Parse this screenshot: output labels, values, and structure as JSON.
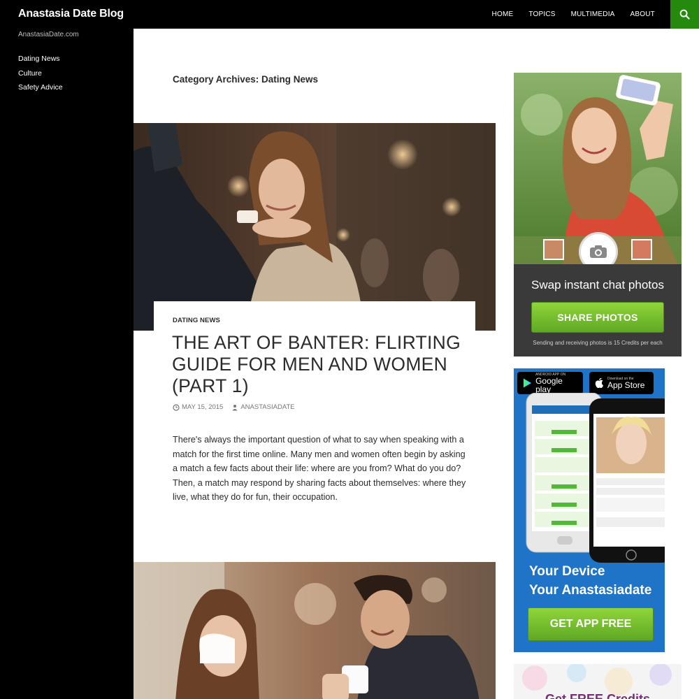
{
  "header": {
    "site_title": "Anastasia Date Blog",
    "nav": [
      "HOME",
      "TOPICS",
      "MULTIMEDIA",
      "ABOUT"
    ],
    "search_icon": "search-icon",
    "accent_color": "#24890d"
  },
  "sidebar": {
    "tagline": "AnastasiaDate.com",
    "categories": [
      "Dating News",
      "Culture",
      "Safety Advice"
    ]
  },
  "main": {
    "archive_title": "Category Archives: Dating News",
    "post": {
      "category": "DATING NEWS",
      "title": "THE ART OF BANTER: FLIRTING GUIDE FOR MEN AND WOMEN (PART 1)",
      "date": "MAY 15, 2015",
      "author": "ANASTASIADATE",
      "excerpt": "There's always the important question of what to say when speaking with a match for the first time online. Many men and women often begin by asking a match a few facts about their life: where are you from? What do you do? Then, a match may respond by sharing facts about themselves: where they live, what they do for fun, their occupation."
    }
  },
  "ads": {
    "photo_ad": {
      "headline": "Swap instant chat photos",
      "button": "SHARE PHOTOS",
      "note": "Sending and receiving photos is 15 Credits per each"
    },
    "app_ad": {
      "google_small": "ANDROID APP ON",
      "google_big": "Google play",
      "apple_small": "Download on the",
      "apple_big": "App Store",
      "line1": "Your Device",
      "line2": "Your Anastasiadate",
      "button": "GET APP FREE"
    },
    "credits_ad": {
      "text": "Get FREE Credits"
    }
  }
}
